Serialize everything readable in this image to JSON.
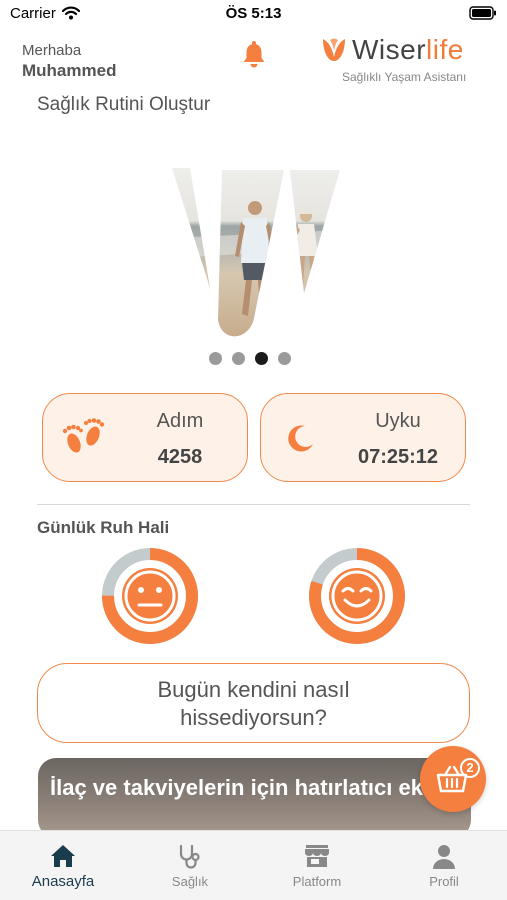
{
  "status_bar": {
    "carrier": "Carrier",
    "time": "ÖS 5:13"
  },
  "header": {
    "greeting": "Merhaba",
    "user_name": "Muhammed",
    "logo": {
      "wiser": "Wiser",
      "life": "life",
      "tagline": "Sağlıklı Yaşam Asistanı"
    }
  },
  "routine": {
    "title": "Sağlık Rutini Oluştur"
  },
  "carousel": {
    "total": 4,
    "active_index": 3
  },
  "stats": {
    "steps": {
      "label": "Adım",
      "value": "4258",
      "icon": "footprints-icon"
    },
    "sleep": {
      "label": "Uyku",
      "value": "07:25:12",
      "icon": "moon-icon"
    }
  },
  "mood": {
    "title": "Günlük Ruh Hali",
    "items": [
      {
        "icon": "neutral-face-icon",
        "level": 0.75
      },
      {
        "icon": "happy-face-icon",
        "level": 0.8
      }
    ]
  },
  "feeling_prompt": {
    "line1": "Bugün kendini nasıl",
    "line2": "hissediyorsun?"
  },
  "banner": {
    "text": "İlaç ve takviyelerin için hatırlatıcı ekle."
  },
  "cart": {
    "badge": "2"
  },
  "tabbar": {
    "items": [
      {
        "label": "Anasayfa",
        "icon": "home-icon"
      },
      {
        "label": "Sağlık",
        "icon": "stethoscope-icon"
      },
      {
        "label": "Platform",
        "icon": "store-icon"
      },
      {
        "label": "Profil",
        "icon": "user-icon"
      }
    ]
  },
  "colors": {
    "accent": "#f47f3f",
    "card_bg": "#fdf1e8",
    "ring_track": "#c3cbcc",
    "tab_active": "#1a3d4e"
  }
}
